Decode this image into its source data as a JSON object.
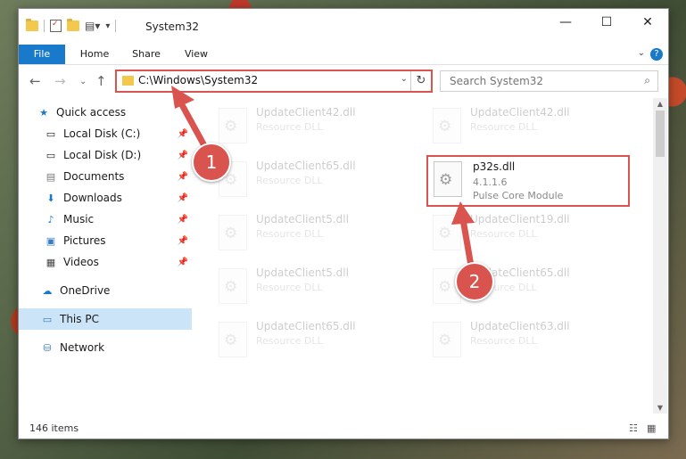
{
  "window": {
    "title": "System32",
    "controls": {
      "minimize": "—",
      "maximize": "☐",
      "close": "✕"
    }
  },
  "ribbon": {
    "tabs": [
      "File",
      "Home",
      "Share",
      "View"
    ]
  },
  "address": {
    "path": "C:\\Windows\\System32"
  },
  "search": {
    "placeholder": "Search System32"
  },
  "sidebar": {
    "items": [
      {
        "label": "Quick access",
        "icon": "star-icon"
      },
      {
        "label": "Local Disk (C:)",
        "icon": "drive-icon",
        "pinned": true
      },
      {
        "label": "Local Disk (D:)",
        "icon": "drive-icon",
        "pinned": true
      },
      {
        "label": "Documents",
        "icon": "documents-icon",
        "pinned": true
      },
      {
        "label": "Downloads",
        "icon": "downloads-icon",
        "pinned": true
      },
      {
        "label": "Music",
        "icon": "music-icon",
        "pinned": true
      },
      {
        "label": "Pictures",
        "icon": "pictures-icon",
        "pinned": true
      },
      {
        "label": "Videos",
        "icon": "videos-icon",
        "pinned": true
      },
      {
        "label": "OneDrive",
        "icon": "cloud-icon"
      },
      {
        "label": "This PC",
        "icon": "computer-icon",
        "selected": true
      },
      {
        "label": "Network",
        "icon": "network-icon"
      }
    ]
  },
  "files": [
    {
      "name": "UpdateClient42.dll",
      "type": "Resource DLL"
    },
    {
      "name": "UpdateClient42.dll",
      "type": "Resource DLL"
    },
    {
      "name": "UpdateClient65.dll",
      "type": "Resource DLL"
    },
    {
      "name": "p32s.dll",
      "version": "4.1.1.6",
      "description": "Pulse Core Module",
      "selected": true
    },
    {
      "name": "UpdateClient5.dll",
      "type": "Resource DLL"
    },
    {
      "name": "UpdateClient19.dll",
      "type": "Resource DLL"
    },
    {
      "name": "UpdateClient5.dll",
      "type": "Resource DLL"
    },
    {
      "name": "UpdateClient65.dll",
      "type": "Resource DLL"
    },
    {
      "name": "UpdateClient65.dll",
      "type": "Resource DLL"
    },
    {
      "name": "UpdateClient63.dll",
      "type": "Resource DLL"
    }
  ],
  "status": {
    "count": "146 items"
  },
  "callouts": [
    "1",
    "2"
  ],
  "accent": "#d9534f",
  "brand": "#1979ca"
}
